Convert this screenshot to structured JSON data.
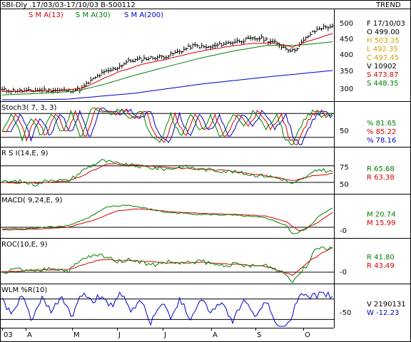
{
  "header": {
    "title": "SBI-Dly .17/03/03-17/10/03  B-500112",
    "trend_label": "TREND",
    "ma_labels": [
      {
        "text": "S M A(13)",
        "color": "#d40000"
      },
      {
        "text": "S M A(30)",
        "color": "#008000"
      },
      {
        "text": "S M A(200)",
        "color": "#0000c8"
      }
    ]
  },
  "colors": {
    "price": "#000000",
    "sma13": "#d40000",
    "sma30": "#008000",
    "sma200": "#0000c8",
    "green": "#008000",
    "red": "#d40000",
    "blue": "#0000c8",
    "frame": "#000000"
  },
  "panels": {
    "price": {
      "title": "",
      "yticks": [
        "500",
        "450",
        "400",
        "350",
        "300"
      ],
      "stats": [
        {
          "text": "F  17/10/03",
          "color": "#000000"
        },
        {
          "text": "O     499.00",
          "color": "#000000"
        },
        {
          "text": "H     503.35",
          "color": "#d8a000"
        },
        {
          "text": "L     492.35",
          "color": "#d8a000"
        },
        {
          "text": "C     497.45",
          "color": "#d8a000"
        },
        {
          "text": "V      10902",
          "color": "#000000"
        },
        {
          "text": "S     473.87",
          "color": "#d40000"
        },
        {
          "text": "S     448.35",
          "color": "#008000"
        }
      ]
    },
    "stoch": {
      "title": "Stoch3( 7, 3, 3)",
      "yticks": [
        "50"
      ],
      "stats": [
        {
          "text": "%     81.65",
          "color": "#008000"
        },
        {
          "text": "%     85.22",
          "color": "#d40000"
        },
        {
          "text": "%     78.16",
          "color": "#0000c8"
        }
      ]
    },
    "rsi": {
      "title": "R S I(14,E, 9)",
      "yticks": [
        "75",
        "50"
      ],
      "stats": [
        {
          "text": "R     65.68",
          "color": "#008000"
        },
        {
          "text": "R     63.38",
          "color": "#d40000"
        }
      ]
    },
    "macd": {
      "title": "MACD( 9,24,E, 9)",
      "yticks": [
        "-0"
      ],
      "stats": [
        {
          "text": "M     20.74",
          "color": "#008000"
        },
        {
          "text": "M     15.99",
          "color": "#d40000"
        }
      ]
    },
    "roc": {
      "title": "ROC(10,E, 9)",
      "yticks": [
        "-0"
      ],
      "stats": [
        {
          "text": "R     41.80",
          "color": "#008000"
        },
        {
          "text": "R     43.49",
          "color": "#d40000"
        }
      ]
    },
    "wlm": {
      "title": "WLM %R(10)",
      "yticks": [
        "-50"
      ],
      "stats": [
        {
          "text": "V  2190131",
          "color": "#000000"
        },
        {
          "text": "W     -12.23",
          "color": "#0000c8"
        }
      ]
    }
  },
  "chart_data": {
    "type": "line",
    "title": "SBI-Dly .17/03/03-17/10/03  B-500112",
    "x_months": [
      "03",
      "A",
      "M",
      "J",
      "J",
      "A",
      "S",
      "O"
    ],
    "price": {
      "ylim": [
        270,
        520
      ],
      "ohlc_last": {
        "date": "17/10/03",
        "open": 499.0,
        "high": 503.35,
        "low": 492.35,
        "close": 497.45,
        "volume": 10902
      },
      "close_anchors": [
        [
          0,
          300
        ],
        [
          0.07,
          296
        ],
        [
          0.12,
          300
        ],
        [
          0.2,
          298
        ],
        [
          0.24,
          304
        ],
        [
          0.26,
          322
        ],
        [
          0.3,
          350
        ],
        [
          0.34,
          365
        ],
        [
          0.38,
          388
        ],
        [
          0.42,
          395
        ],
        [
          0.46,
          400
        ],
        [
          0.5,
          405
        ],
        [
          0.54,
          420
        ],
        [
          0.58,
          437
        ],
        [
          0.62,
          430
        ],
        [
          0.66,
          440
        ],
        [
          0.7,
          448
        ],
        [
          0.74,
          455
        ],
        [
          0.78,
          460
        ],
        [
          0.82,
          448
        ],
        [
          0.86,
          428
        ],
        [
          0.88,
          420
        ],
        [
          0.9,
          438
        ],
        [
          0.93,
          470
        ],
        [
          0.96,
          490
        ],
        [
          1,
          497.45
        ]
      ],
      "sma13_anchors": [
        [
          0,
          295
        ],
        [
          0.1,
          297
        ],
        [
          0.2,
          300
        ],
        [
          0.25,
          308
        ],
        [
          0.3,
          332
        ],
        [
          0.35,
          355
        ],
        [
          0.42,
          378
        ],
        [
          0.5,
          395
        ],
        [
          0.58,
          415
        ],
        [
          0.66,
          430
        ],
        [
          0.74,
          442
        ],
        [
          0.82,
          445
        ],
        [
          0.88,
          432
        ],
        [
          0.94,
          455
        ],
        [
          1,
          473.87
        ]
      ],
      "sma30_anchors": [
        [
          0,
          285
        ],
        [
          0.12,
          290
        ],
        [
          0.22,
          296
        ],
        [
          0.3,
          315
        ],
        [
          0.4,
          345
        ],
        [
          0.5,
          372
        ],
        [
          0.6,
          398
        ],
        [
          0.7,
          420
        ],
        [
          0.8,
          437
        ],
        [
          0.88,
          437
        ],
        [
          0.94,
          442
        ],
        [
          1,
          448.35
        ]
      ],
      "sma200_anchors": [
        [
          0,
          268
        ],
        [
          0.2,
          272
        ],
        [
          0.4,
          290
        ],
        [
          0.6,
          318
        ],
        [
          0.8,
          340
        ],
        [
          1,
          360
        ]
      ]
    },
    "stoch": {
      "ylim": [
        0,
        100
      ],
      "levels": [
        20,
        80
      ],
      "last": {
        "k": 81.65,
        "d": 85.22,
        "sig": 78.16
      },
      "anchors": [
        [
          0,
          40
        ],
        [
          0.03,
          80
        ],
        [
          0.06,
          15
        ],
        [
          0.09,
          70
        ],
        [
          0.12,
          20
        ],
        [
          0.15,
          85
        ],
        [
          0.18,
          30
        ],
        [
          0.21,
          85
        ],
        [
          0.24,
          15
        ],
        [
          0.27,
          90
        ],
        [
          0.3,
          85
        ],
        [
          0.33,
          80
        ],
        [
          0.36,
          90
        ],
        [
          0.39,
          70
        ],
        [
          0.42,
          85
        ],
        [
          0.45,
          30
        ],
        [
          0.48,
          10
        ],
        [
          0.51,
          80
        ],
        [
          0.54,
          20
        ],
        [
          0.57,
          80
        ],
        [
          0.6,
          30
        ],
        [
          0.63,
          75
        ],
        [
          0.66,
          15
        ],
        [
          0.7,
          80
        ],
        [
          0.73,
          50
        ],
        [
          0.76,
          85
        ],
        [
          0.8,
          40
        ],
        [
          0.83,
          80
        ],
        [
          0.86,
          10
        ],
        [
          0.88,
          5
        ],
        [
          0.91,
          60
        ],
        [
          0.94,
          88
        ],
        [
          0.97,
          70
        ],
        [
          1,
          81.65
        ]
      ]
    },
    "rsi": {
      "ylim": [
        35,
        95
      ],
      "levels": [
        75,
        50
      ],
      "last": {
        "rsi": 65.68,
        "signal": 63.38
      },
      "rsi_anchors": [
        [
          0,
          50
        ],
        [
          0.05,
          52
        ],
        [
          0.1,
          47
        ],
        [
          0.15,
          55
        ],
        [
          0.2,
          52
        ],
        [
          0.25,
          70
        ],
        [
          0.3,
          83
        ],
        [
          0.35,
          78
        ],
        [
          0.4,
          75
        ],
        [
          0.45,
          72
        ],
        [
          0.5,
          70
        ],
        [
          0.55,
          74
        ],
        [
          0.6,
          70
        ],
        [
          0.65,
          68
        ],
        [
          0.7,
          66
        ],
        [
          0.75,
          62
        ],
        [
          0.8,
          60
        ],
        [
          0.85,
          55
        ],
        [
          0.88,
          47
        ],
        [
          0.92,
          58
        ],
        [
          0.96,
          70
        ],
        [
          1,
          65.68
        ]
      ],
      "signal_anchors": [
        [
          0,
          50
        ],
        [
          0.1,
          49
        ],
        [
          0.2,
          52
        ],
        [
          0.25,
          62
        ],
        [
          0.32,
          78
        ],
        [
          0.4,
          76
        ],
        [
          0.5,
          72
        ],
        [
          0.6,
          70
        ],
        [
          0.7,
          67
        ],
        [
          0.8,
          60
        ],
        [
          0.88,
          52
        ],
        [
          0.94,
          60
        ],
        [
          1,
          63.38
        ]
      ]
    },
    "macd": {
      "ylim": [
        -10,
        30
      ],
      "levels": [
        0
      ],
      "last": {
        "macd": 20.74,
        "signal": 15.99
      },
      "macd_anchors": [
        [
          0,
          -2
        ],
        [
          0.1,
          -1
        ],
        [
          0.2,
          2
        ],
        [
          0.26,
          10
        ],
        [
          0.32,
          22
        ],
        [
          0.38,
          24
        ],
        [
          0.44,
          20
        ],
        [
          0.5,
          16
        ],
        [
          0.6,
          14
        ],
        [
          0.7,
          13
        ],
        [
          0.8,
          10
        ],
        [
          0.86,
          2
        ],
        [
          0.88,
          -8
        ],
        [
          0.92,
          -2
        ],
        [
          0.96,
          12
        ],
        [
          1,
          20.74
        ]
      ],
      "signal_anchors": [
        [
          0,
          -3
        ],
        [
          0.1,
          -2
        ],
        [
          0.2,
          0
        ],
        [
          0.28,
          8
        ],
        [
          0.35,
          18
        ],
        [
          0.42,
          20
        ],
        [
          0.5,
          17
        ],
        [
          0.6,
          15
        ],
        [
          0.7,
          14
        ],
        [
          0.8,
          12
        ],
        [
          0.86,
          6
        ],
        [
          0.9,
          -4
        ],
        [
          0.95,
          4
        ],
        [
          1,
          15.99
        ]
      ]
    },
    "roc": {
      "ylim": [
        -20,
        50
      ],
      "levels": [
        0
      ],
      "last": {
        "roc": 41.8,
        "signal": 43.49
      },
      "roc_anchors": [
        [
          0,
          0
        ],
        [
          0.05,
          5
        ],
        [
          0.1,
          0
        ],
        [
          0.15,
          8
        ],
        [
          0.2,
          2
        ],
        [
          0.25,
          25
        ],
        [
          0.3,
          30
        ],
        [
          0.35,
          20
        ],
        [
          0.4,
          22
        ],
        [
          0.45,
          12
        ],
        [
          0.5,
          18
        ],
        [
          0.55,
          15
        ],
        [
          0.6,
          20
        ],
        [
          0.65,
          12
        ],
        [
          0.7,
          14
        ],
        [
          0.75,
          10
        ],
        [
          0.8,
          12
        ],
        [
          0.85,
          0
        ],
        [
          0.88,
          -15
        ],
        [
          0.92,
          10
        ],
        [
          0.95,
          45
        ],
        [
          1,
          41.8
        ]
      ],
      "signal_anchors": [
        [
          0,
          1
        ],
        [
          0.1,
          3
        ],
        [
          0.2,
          5
        ],
        [
          0.3,
          22
        ],
        [
          0.4,
          20
        ],
        [
          0.5,
          16
        ],
        [
          0.6,
          17
        ],
        [
          0.7,
          14
        ],
        [
          0.8,
          10
        ],
        [
          0.88,
          -5
        ],
        [
          0.93,
          20
        ],
        [
          1,
          43.49
        ]
      ]
    },
    "wlm": {
      "ylim": [
        -100,
        0
      ],
      "levels": [
        -20,
        -80
      ],
      "last": {
        "volume": 2190131,
        "wpr": -12.23
      },
      "anchors": [
        [
          0,
          -20
        ],
        [
          0.03,
          -70
        ],
        [
          0.06,
          -10
        ],
        [
          0.09,
          -80
        ],
        [
          0.12,
          -20
        ],
        [
          0.15,
          -60
        ],
        [
          0.18,
          -10
        ],
        [
          0.21,
          -75
        ],
        [
          0.24,
          -5
        ],
        [
          0.27,
          -30
        ],
        [
          0.3,
          -10
        ],
        [
          0.33,
          -40
        ],
        [
          0.36,
          -5
        ],
        [
          0.39,
          -60
        ],
        [
          0.42,
          -20
        ],
        [
          0.45,
          -90
        ],
        [
          0.48,
          -30
        ],
        [
          0.51,
          -70
        ],
        [
          0.54,
          -20
        ],
        [
          0.57,
          -80
        ],
        [
          0.6,
          -15
        ],
        [
          0.63,
          -60
        ],
        [
          0.66,
          -30
        ],
        [
          0.7,
          -85
        ],
        [
          0.73,
          -20
        ],
        [
          0.76,
          -70
        ],
        [
          0.8,
          -30
        ],
        [
          0.83,
          -95
        ],
        [
          0.86,
          -98
        ],
        [
          0.88,
          -60
        ],
        [
          0.9,
          -10
        ],
        [
          0.93,
          -20
        ],
        [
          0.96,
          -5
        ],
        [
          1,
          -12.23
        ]
      ]
    }
  }
}
